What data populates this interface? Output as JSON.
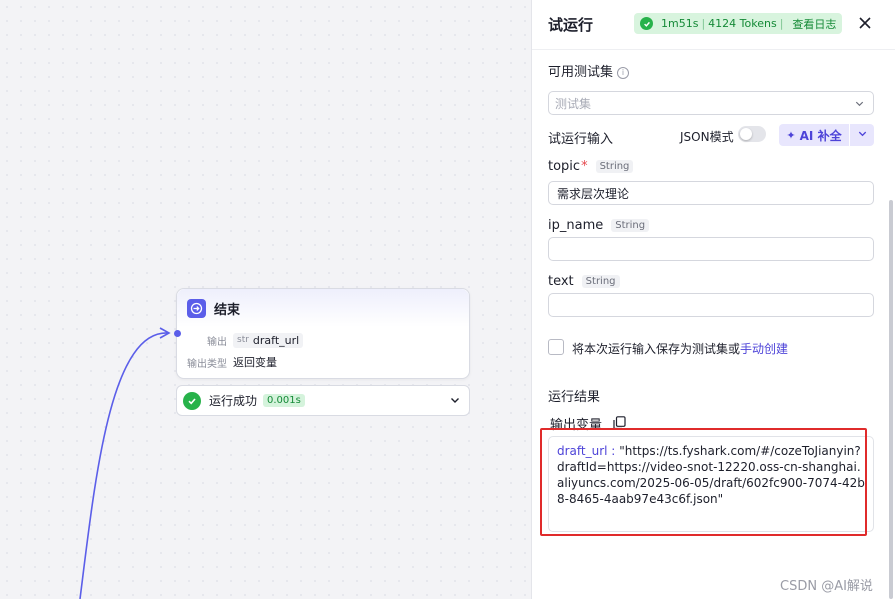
{
  "canvas": {
    "end_node": {
      "title": "结束",
      "output_label": "输出",
      "output_var_type": "str",
      "output_var_name": "draft_url",
      "output_type_label": "输出类型",
      "output_type_value": "返回变量"
    },
    "run_status": {
      "label": "运行成功",
      "duration": "0.001s"
    }
  },
  "panel": {
    "title": "试运行",
    "status": {
      "duration": "1m51s",
      "tokens": "4124 Tokens",
      "view_log": "查看日志"
    },
    "test_set_label": "可用测试集",
    "test_set_placeholder": "测试集",
    "trial_input_label": "试运行输入",
    "json_mode_label": "JSON模式",
    "ai_button_label": "AI 补全",
    "fields": [
      {
        "name": "topic",
        "type": "String",
        "required": true,
        "value": "需求层次理论"
      },
      {
        "name": "ip_name",
        "type": "String",
        "required": false,
        "value": ""
      },
      {
        "name": "text",
        "type": "String",
        "required": false,
        "value": ""
      }
    ],
    "save_option_text": "将本次运行输入保存为测试集或",
    "save_option_link": "手动创建",
    "result_label": "运行结果",
    "output_var_label": "输出变量",
    "result": {
      "key": "draft_url :",
      "value": "\"https://ts.fyshark.com/#/cozeToJianyin?draftId=https://video-snot-12220.oss-cn-shanghai.aliyuncs.com/2025-06-05/draft/602fc900-7074-42b8-8465-4aab97e43c6f.json\""
    }
  },
  "watermark": "CSDN @AI解说",
  "colors": {
    "accent": "#5b5ee9",
    "success": "#27b24a",
    "highlight": "#e02b2b"
  }
}
